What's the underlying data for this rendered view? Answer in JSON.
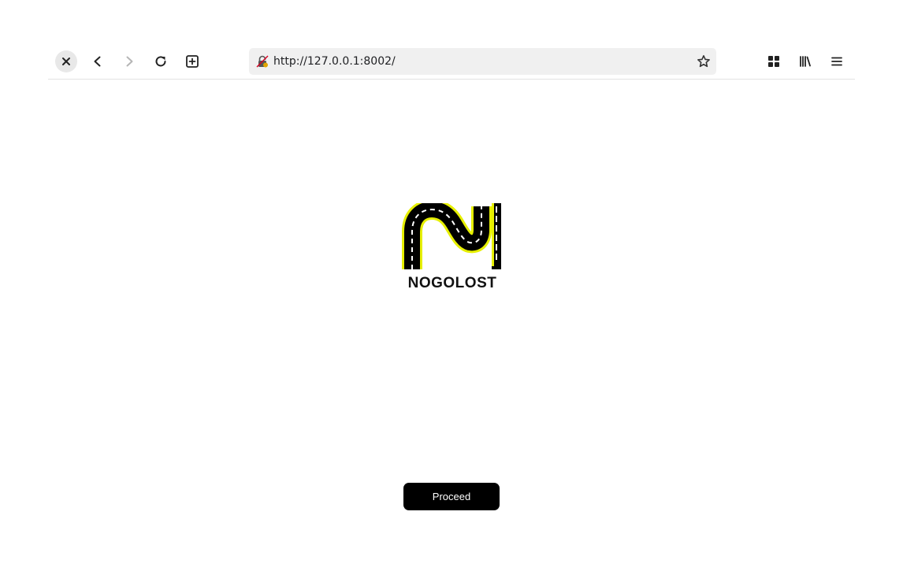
{
  "browser": {
    "url": "http://127.0.0.1:8002/",
    "icons": {
      "stop": "close-icon",
      "back": "back-arrow-icon",
      "forward": "forward-arrow-icon",
      "reload": "reload-icon",
      "new_tab": "new-tab-icon",
      "security": "insecure-lock-icon",
      "bookmark": "star-icon",
      "extensions": "grid-icon",
      "library": "library-icon",
      "menu": "hamburger-menu-icon"
    }
  },
  "page": {
    "logo_text": "NOGOLOST",
    "proceed_label": "Proceed"
  },
  "colors": {
    "road": "#000000",
    "road_edge": "#e6ef00",
    "road_dash": "#ffffff",
    "button_bg": "#000000",
    "button_text": "#ffffff"
  }
}
